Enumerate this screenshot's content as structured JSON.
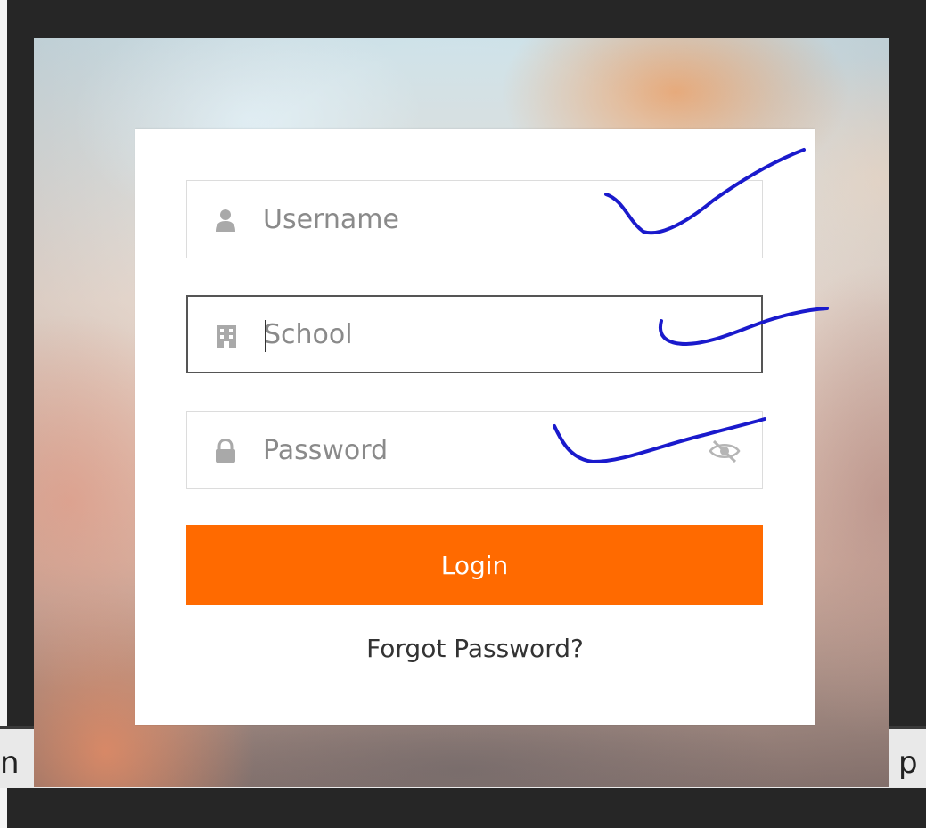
{
  "login_form": {
    "username": {
      "value": "",
      "placeholder": "Username",
      "icon": "user-icon"
    },
    "school": {
      "value": "",
      "placeholder": "School",
      "icon": "building-icon"
    },
    "password": {
      "value": "",
      "placeholder": "Password",
      "icon": "lock-icon",
      "toggle_icon": "eye-slash-icon"
    },
    "login_label": "Login",
    "forgot_label": "Forgot Password?"
  },
  "background_edge_text": {
    "left": "n",
    "right": "p"
  },
  "colors": {
    "accent": "#ff6a00",
    "annotation_ink": "#1a1acc",
    "card": "#ffffff",
    "frame": "#262626"
  }
}
